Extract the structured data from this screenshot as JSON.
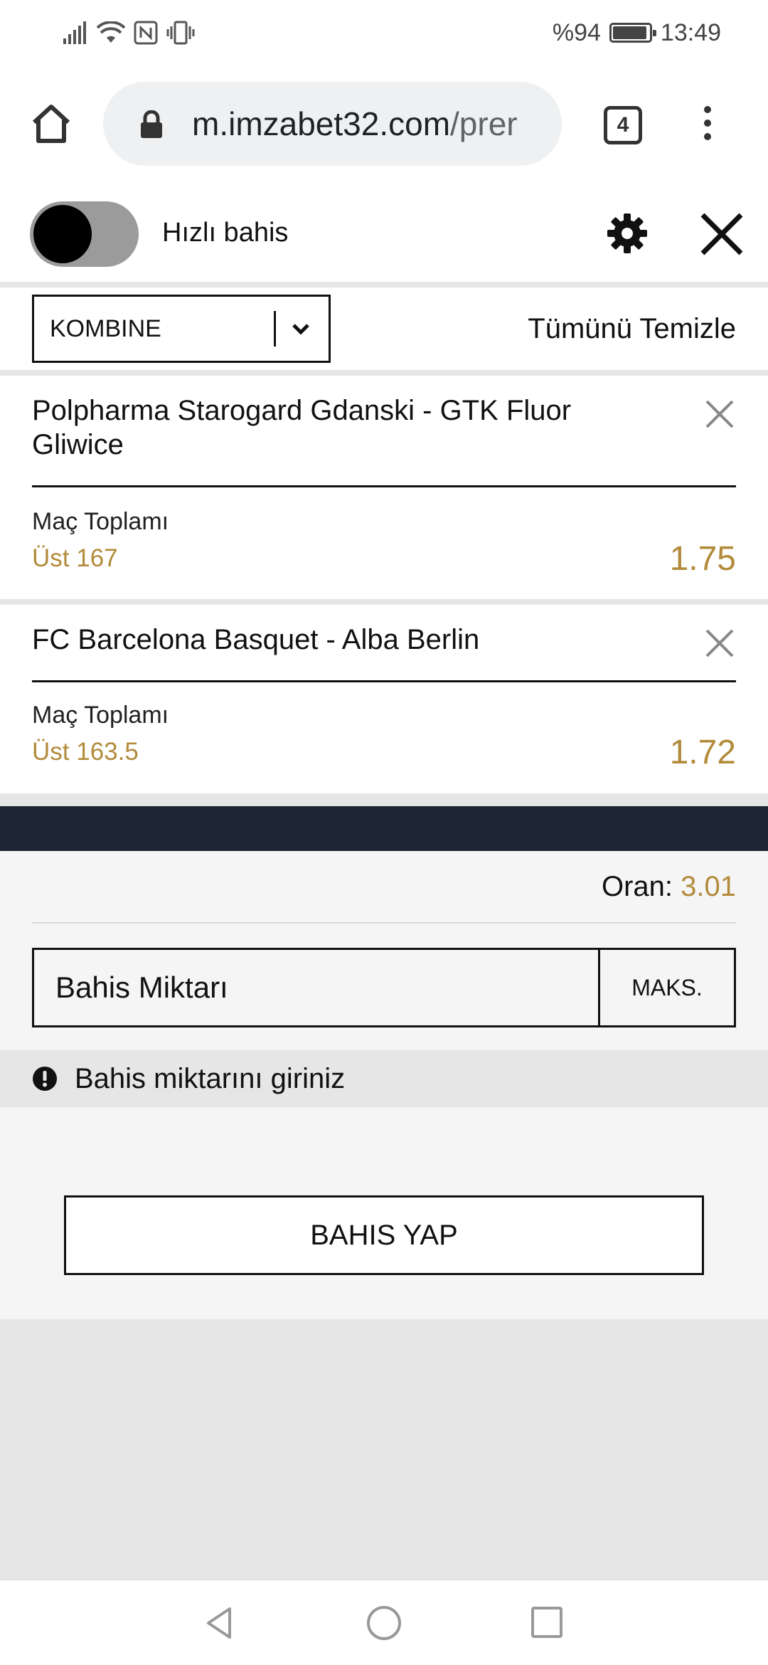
{
  "status_bar": {
    "battery_text": "%94",
    "battery_level": 0.94,
    "time": "13:49",
    "icons": [
      "signal-icon",
      "wifi-icon",
      "nfc-icon",
      "vibrate-icon",
      "battery-icon"
    ]
  },
  "browser": {
    "url_main": "m.imzabet32.com",
    "url_rest": "/prer",
    "tab_count": "4"
  },
  "slip": {
    "quick_bet_label": "Hızlı bahis",
    "quick_bet_enabled": false,
    "bet_type": "KOMBINE",
    "clear_all_label": "Tümünü Temizle"
  },
  "bets": [
    {
      "match": "Polpharma Starogard Gdanski - GTK Fluor Gliwice",
      "market": "Maç Toplamı",
      "selection": "Üst 167",
      "odds": "1.75"
    },
    {
      "match": "FC Barcelona Basquet - Alba Berlin",
      "market": "Maç Toplamı",
      "selection": "Üst 163.5",
      "odds": "1.72"
    }
  ],
  "summary": {
    "odds_label": "Oran:",
    "odds_value": "3.01",
    "stake_placeholder": "Bahis Miktarı",
    "max_label": "MAKS.",
    "warning_text": "Bahis miktarını giriniz",
    "place_bet_label": "BAHIS YAP"
  },
  "colors": {
    "accent_gold": "#b28b3b",
    "dark_band": "#1e2534",
    "toggle_track": "#9b9b9b"
  }
}
